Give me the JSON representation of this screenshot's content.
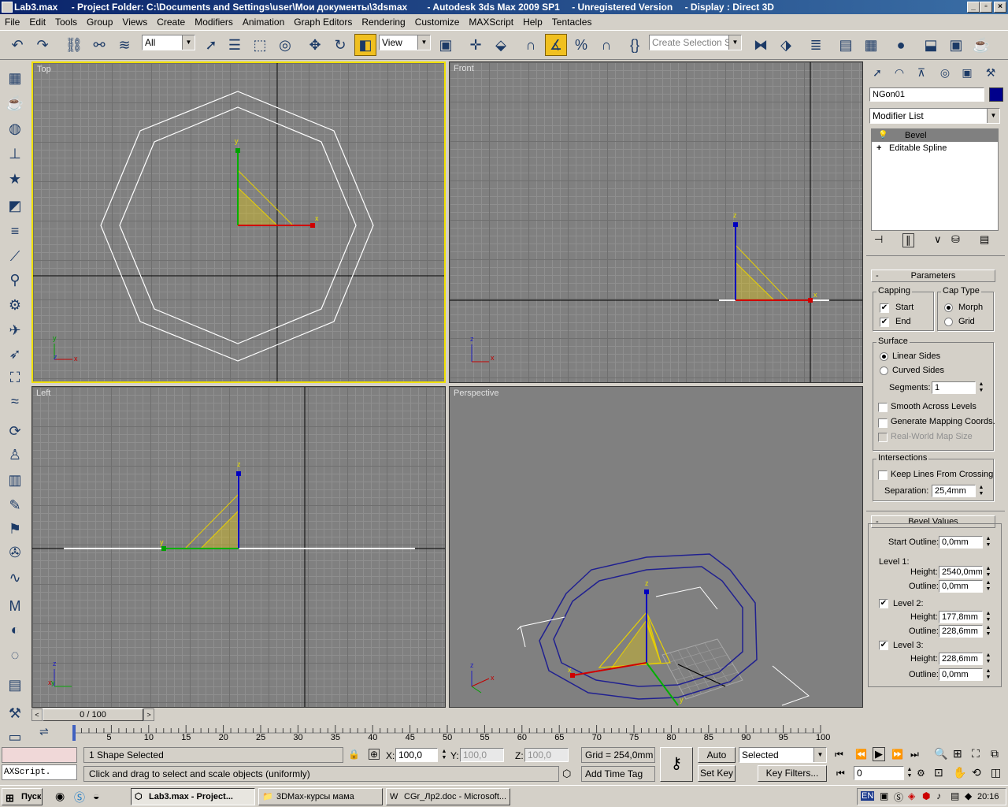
{
  "window": {
    "file": "Lab3.max",
    "project": "- Project Folder: C:\\Documents and Settings\\user\\Мои документы\\3dsmax",
    "app": "- Autodesk 3ds Max  2009 SP1",
    "version": "- Unregistered Version",
    "display": "- Display : Direct 3D"
  },
  "menu": [
    "File",
    "Edit",
    "Tools",
    "Group",
    "Views",
    "Create",
    "Modifiers",
    "Animation",
    "Graph Editors",
    "Rendering",
    "Customize",
    "MAXScript",
    "Help",
    "Tentacles"
  ],
  "toolbar": {
    "filter": "All",
    "refcoord": "View",
    "selection_set": "Create Selection Set"
  },
  "viewports": {
    "top": "Top",
    "front": "Front",
    "left": "Left",
    "perspective": "Perspective"
  },
  "axes": {
    "x": "x",
    "y": "y",
    "z": "z"
  },
  "command": {
    "object_name": "NGon01",
    "object_color": "#00008b",
    "modifier_list": "Modifier List",
    "stack": [
      "Bevel",
      "Editable Spline"
    ]
  },
  "parameters": {
    "title": "Parameters",
    "capping": "Capping",
    "start": "Start",
    "end": "End",
    "cap_type": "Cap Type",
    "morph": "Morph",
    "grid": "Grid",
    "surface": "Surface",
    "linear": "Linear Sides",
    "curved": "Curved Sides",
    "segments_label": "Segments:",
    "segments": "1",
    "smooth": "Smooth Across Levels",
    "gen_map": "Generate Mapping Coords.",
    "real_world": "Real-World Map Size",
    "intersections": "Intersections",
    "keep_lines": "Keep Lines From Crossing",
    "separation_label": "Separation:",
    "separation": "25,4mm"
  },
  "bevel_values": {
    "title": "Bevel Values",
    "start_outline_label": "Start Outline:",
    "start_outline": "0,0mm",
    "level1": "Level 1:",
    "height_label": "Height:",
    "outline_label": "Outline:",
    "l1_height": "2540,0mm",
    "l1_outline": "0,0mm",
    "level2": "Level 2:",
    "l2_height": "177,8mm",
    "l2_outline": "228,6mm",
    "level3": "Level 3:",
    "l3_height": "228,6mm",
    "l3_outline": "0,0mm"
  },
  "time": {
    "slider": "0 / 100",
    "ticks": [
      "5",
      "10",
      "15",
      "20",
      "25",
      "30",
      "35",
      "40",
      "45",
      "50",
      "55",
      "60",
      "65",
      "70",
      "75",
      "80",
      "85",
      "90",
      "95",
      "100"
    ]
  },
  "status": {
    "script": "AXScript.",
    "selected": "1 Shape Selected",
    "prompt": "Click and drag to select and scale objects (uniformly)",
    "x_label": "X:",
    "x": "100,0",
    "y_label": "Y:",
    "y": "100,0",
    "z_label": "Z:",
    "z": "100,0",
    "grid": "Grid = 254,0mm",
    "add_time_tag": "Add Time Tag",
    "auto_key": "Auto Key",
    "set_key": "Set Key",
    "key_mode": "Selected",
    "key_filters": "Key Filters...",
    "frame": "0"
  },
  "taskbar": {
    "start": "Пуск",
    "tasks": [
      "Lab3.max     - Project...",
      "3DMax-курсы мама",
      "CGr_Лр2.doc - Microsoft..."
    ],
    "lang": "EN",
    "clock": "20:16"
  }
}
